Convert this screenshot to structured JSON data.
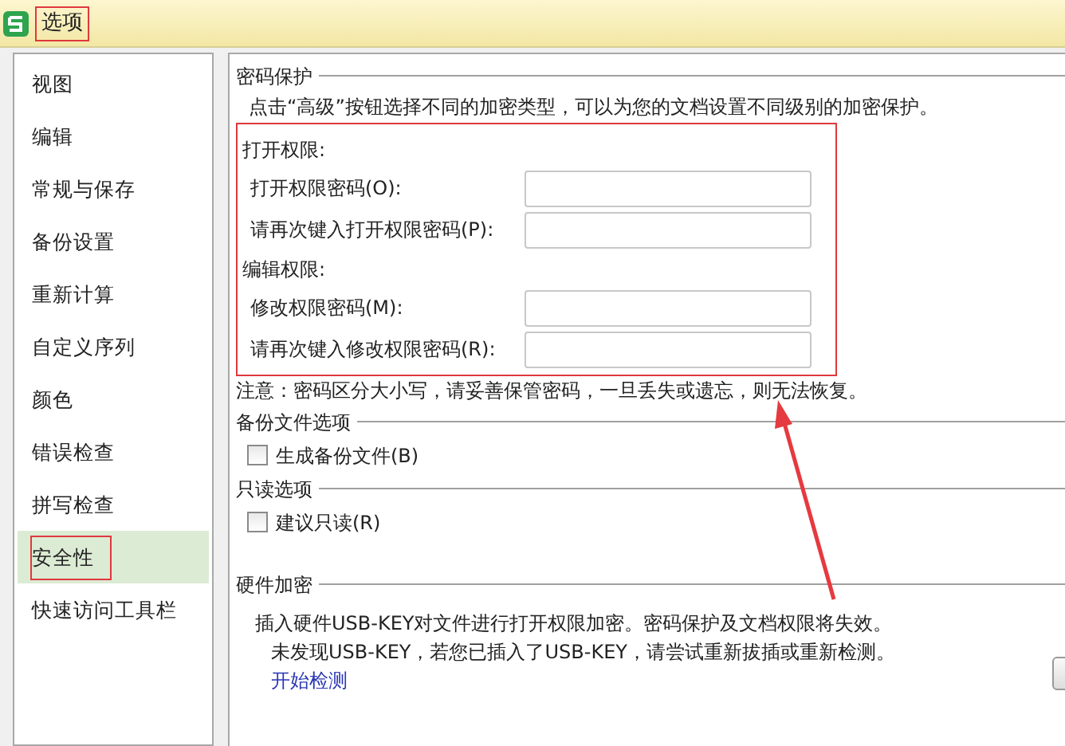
{
  "window": {
    "title": "选项",
    "highlighted": true
  },
  "sidebar": {
    "items": [
      {
        "label": "视图",
        "selected": false,
        "highlighted": false
      },
      {
        "label": "编辑",
        "selected": false,
        "highlighted": false
      },
      {
        "label": "常规与保存",
        "selected": false,
        "highlighted": false
      },
      {
        "label": "备份设置",
        "selected": false,
        "highlighted": false
      },
      {
        "label": "重新计算",
        "selected": false,
        "highlighted": false
      },
      {
        "label": "自定义序列",
        "selected": false,
        "highlighted": false
      },
      {
        "label": "颜色",
        "selected": false,
        "highlighted": false
      },
      {
        "label": "错误检查",
        "selected": false,
        "highlighted": false
      },
      {
        "label": "拼写检查",
        "selected": false,
        "highlighted": false
      },
      {
        "label": "安全性",
        "selected": true,
        "highlighted": true
      },
      {
        "label": "快速访问工具栏",
        "selected": false,
        "highlighted": false
      }
    ]
  },
  "password_protection": {
    "title": "密码保护",
    "hint": "点击“高级”按钮选择不同的加密类型，可以为您的文档设置不同级别的加密保护。",
    "highlighted": true,
    "groups": [
      {
        "title": "打开权限:",
        "fields": [
          {
            "label": "打开权限密码(O):"
          },
          {
            "label": "请再次键入打开权限密码(P):"
          }
        ]
      },
      {
        "title": "编辑权限:",
        "fields": [
          {
            "label": "修改权限密码(M):"
          },
          {
            "label": "请再次键入修改权限密码(R):"
          }
        ]
      }
    ],
    "note": "注意：密码区分大小写，请妥善保管密码，一旦丢失或遗忘，则无法恢复。"
  },
  "backup_options": {
    "title": "备份文件选项",
    "checkbox": {
      "label": "生成备份文件(B)",
      "checked": false
    }
  },
  "readonly_options": {
    "title": "只读选项",
    "checkbox": {
      "label": "建议只读(R)",
      "checked": false
    }
  },
  "hardware_encryption": {
    "title": "硬件加密",
    "description": "插入硬件USB-KEY对文件进行打开权限加密。密码保护及文档权限将失效。",
    "status": "未发现USB-KEY，若您已插入了USB-KEY，请尝试重新拔插或重新检测。",
    "link": "开始检测"
  }
}
